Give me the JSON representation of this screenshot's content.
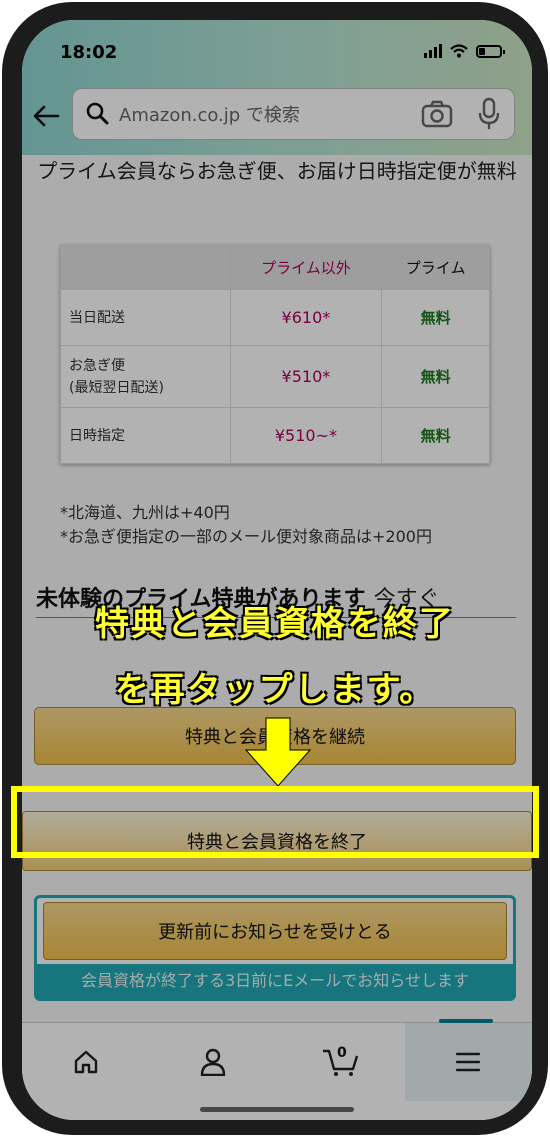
{
  "status_bar": {
    "time": "18:02"
  },
  "search": {
    "placeholder": "Amazon.co.jp で検索"
  },
  "intro": "プライム会員ならお急ぎ便、お届け日時指定便が無料",
  "table": {
    "headers": [
      "",
      "プライム以外",
      "プライム"
    ],
    "rows": [
      {
        "label_line1": "当日配送",
        "label_line2": "",
        "nonprime": "¥610*",
        "prime": "無料"
      },
      {
        "label_line1": "お急ぎ便",
        "label_line2": "(最短翌日配送)",
        "nonprime": "¥510*",
        "prime": "無料"
      },
      {
        "label_line1": "日時指定",
        "label_line2": "",
        "nonprime": "¥510~*",
        "prime": "無料"
      }
    ]
  },
  "notes": [
    "*北海道、九州は+40円",
    "*お急ぎ便指定の一部のメール便対象商品は+200円"
  ],
  "benefit": {
    "text": "未体験のプライム特典があります",
    "link": "今すぐ"
  },
  "buttons": {
    "continue": "特典と会員資格を継続",
    "end": "特典と会員資格を終了",
    "notify": "更新前にお知らせを受けとる"
  },
  "notify_caption": "会員資格が終了する3日前にEメールでお知らせします",
  "cart": {
    "count": "0"
  },
  "overlay": {
    "line1": "特典と会員資格を終了",
    "line2": "を再タップします。",
    "highlight_color": "#ffff00"
  },
  "icons": [
    "back-arrow-icon",
    "search-icon",
    "camera-icon",
    "mic-icon",
    "home-icon",
    "account-icon",
    "cart-icon",
    "menu-icon",
    "down-arrow-icon"
  ]
}
